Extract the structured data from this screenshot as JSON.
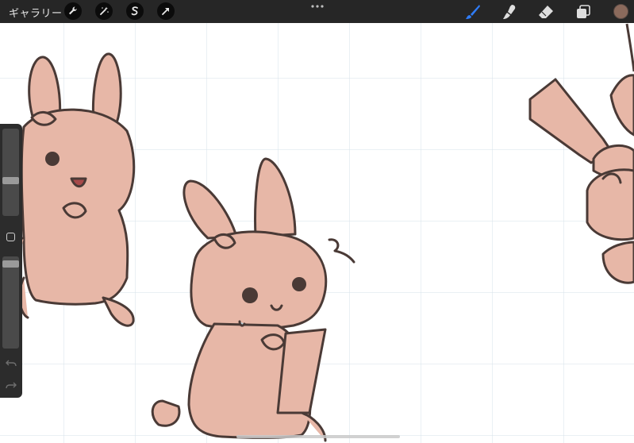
{
  "app": {
    "name": "Procreate"
  },
  "topbar": {
    "gallery_label": "ギャラリー",
    "left_tools": [
      "wrench-icon",
      "magic-wand-icon",
      "selection-s-icon",
      "transform-arrow-icon"
    ],
    "more_icon": "ellipsis-icon",
    "right_tools": [
      "brush-icon",
      "smudge-icon",
      "eraser-icon",
      "layers-icon"
    ],
    "active_tool": "brush",
    "active_color": "#8b6a5c",
    "accent_color": "#2f7cf6"
  },
  "sidebar": {
    "brush_size_level": 0.4,
    "opacity_level": 0.05,
    "modify_button": "square-icon",
    "undo_icon": "undo-icon",
    "redo_icon": "redo-icon"
  },
  "canvas": {
    "grid_color": "#d6e2ea",
    "fill_color": "#e7b7a7",
    "line_color": "#4a3a36"
  }
}
